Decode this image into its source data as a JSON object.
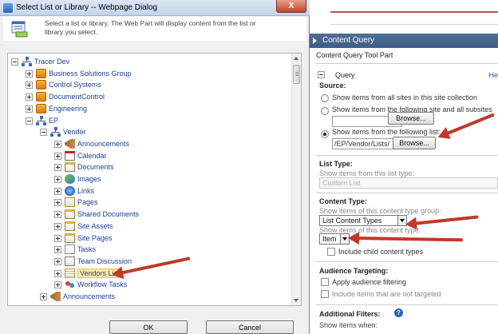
{
  "dialog": {
    "title": "Select List or Library -- Webpage Dialog",
    "close_label": "X",
    "info_text": "Select a list or library. The Web Part will display content from the list or library you select.",
    "ok_label": "OK",
    "cancel_label": "Cancel",
    "tree": [
      {
        "label": "Tracer Dev",
        "icon": "site-icon",
        "expander": "minus"
      },
      {
        "label": "Business Solutions Group",
        "icon": "subsite-icon",
        "expander": "plus"
      },
      {
        "label": "Control Systems",
        "icon": "subsite-icon",
        "expander": "plus"
      },
      {
        "label": "DocumentControl",
        "icon": "subsite-icon",
        "expander": "plus"
      },
      {
        "label": "Engineering",
        "icon": "subsite-icon",
        "expander": "plus"
      },
      {
        "label": "EP",
        "icon": "site-icon",
        "expander": "minus"
      },
      {
        "label": "Vendor",
        "icon": "site-icon",
        "expander": "minus"
      },
      {
        "label": "Announcements",
        "icon": "announcement-icon",
        "expander": "plus"
      },
      {
        "label": "Calendar",
        "icon": "calendar-icon",
        "expander": "plus"
      },
      {
        "label": "Documents",
        "icon": "document-library-icon",
        "expander": "plus"
      },
      {
        "label": "Images",
        "icon": "image-library-icon",
        "expander": "plus"
      },
      {
        "label": "Links",
        "icon": "links-icon",
        "expander": "plus"
      },
      {
        "label": "Pages",
        "icon": "pages-icon",
        "expander": "plus"
      },
      {
        "label": "Shared Documents",
        "icon": "document-library-icon",
        "expander": "plus"
      },
      {
        "label": "Site Assets",
        "icon": "document-library-icon",
        "expander": "plus"
      },
      {
        "label": "Site Pages",
        "icon": "document-library-icon",
        "expander": "plus"
      },
      {
        "label": "Tasks",
        "icon": "tasks-icon",
        "expander": "plus"
      },
      {
        "label": "Team Discussion",
        "icon": "discussion-icon",
        "expander": "plus"
      },
      {
        "label": "Vendors List",
        "icon": "list-icon",
        "expander": "plus",
        "selected": true
      },
      {
        "label": "Workflow Tasks",
        "icon": "workflow-icon",
        "expander": "plus"
      },
      {
        "label": "Announcements",
        "icon": "announcement-icon",
        "expander": "plus"
      }
    ]
  },
  "toolpart": {
    "header_title": "Content Query",
    "title": "Content Query Tool Part",
    "query_label": "Query",
    "help_link": "He",
    "source_label": "Source:",
    "radio_all": "Show items from all sites in this site collection",
    "radio_site": "Show items from the following site and all subsites",
    "radio_list": "Show items from the following list:",
    "site_value": "",
    "list_value": "/EP/Vendor/Lists/",
    "browse_label": "Browse...",
    "list_type_label": "List Type:",
    "list_type_sub": "Show items from this list type:",
    "list_type_value": "Custom List",
    "content_type_label": "Content Type:",
    "content_type_group_sub": "Show items of this content type group:",
    "content_type_group_value": "List Content Types",
    "content_type_sub": "Show items of this content type:",
    "content_type_value": "Item",
    "include_child": "Include child content types",
    "audience_label": "Audience Targeting:",
    "apply_audience": "Apply audience filtering",
    "include_not_targeted": "Include items that are not targeted",
    "filters_label": "Additional Filters:",
    "filters_help": "?",
    "show_when": "Show items when:"
  }
}
